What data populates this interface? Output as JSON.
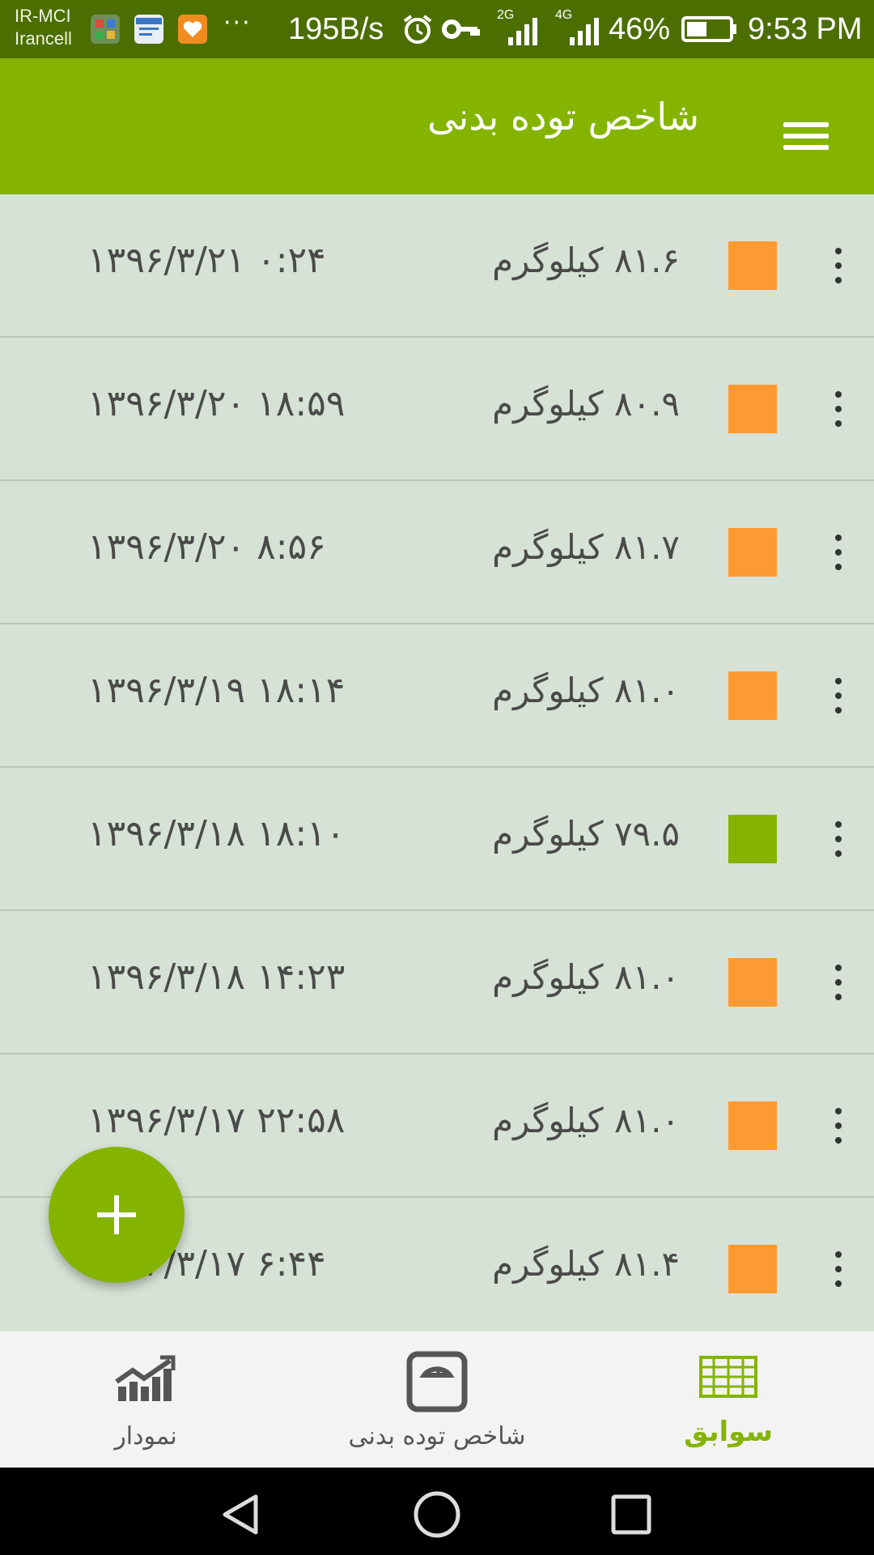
{
  "status_bar": {
    "carrier_line1": "IR-MCI",
    "carrier_line2": "Irancell",
    "more": "···",
    "net_speed": "195B/s",
    "signal_1_label": "2G",
    "signal_2_label": "4G",
    "battery_percent": "46%",
    "time": "9:53 PM"
  },
  "app_bar": {
    "title": "شاخص توده بدنی",
    "menu_icon": "hamburger-menu-icon"
  },
  "colors": {
    "primary": "#85b400",
    "status_bar": "#4c6e00",
    "list_bg": "#d5e2d5",
    "overweight": "#ff9a33",
    "normal": "#85b400",
    "nav_active": "#85b400",
    "nav_inactive": "#555555"
  },
  "records": [
    {
      "weight": "۸۱.۶ کیلوگرم",
      "date": "۱۳۹۶/۳/۲۱ ۰:۲۴",
      "status_color": "#ff9a33"
    },
    {
      "weight": "۸۰.۹ کیلوگرم",
      "date": "۱۳۹۶/۳/۲۰ ۱۸:۵۹",
      "status_color": "#ff9a33"
    },
    {
      "weight": "۸۱.۷ کیلوگرم",
      "date": "۱۳۹۶/۳/۲۰ ۸:۵۶",
      "status_color": "#ff9a33"
    },
    {
      "weight": "۸۱.۰ کیلوگرم",
      "date": "۱۳۹۶/۳/۱۹ ۱۸:۱۴",
      "status_color": "#ff9a33"
    },
    {
      "weight": "۷۹.۵ کیلوگرم",
      "date": "۱۳۹۶/۳/۱۸ ۱۸:۱۰",
      "status_color": "#85b400"
    },
    {
      "weight": "۸۱.۰ کیلوگرم",
      "date": "۱۳۹۶/۳/۱۸ ۱۴:۲۳",
      "status_color": "#ff9a33"
    },
    {
      "weight": "۸۱.۰ کیلوگرم",
      "date": "۱۳۹۶/۳/۱۷ ۲۲:۵۸",
      "status_color": "#ff9a33"
    },
    {
      "weight": "۸۱.۴ کیلوگرم",
      "date": "۱۳۹۶/۳/۱۷ ۶:۴۴",
      "status_color": "#ff9a33"
    }
  ],
  "fab": {
    "icon": "plus-icon"
  },
  "bottom_nav": {
    "tabs": [
      {
        "label": "سوابق",
        "icon": "table-grid-icon",
        "active": true
      },
      {
        "label": "شاخص توده بدنی",
        "icon": "scale-icon",
        "active": false
      },
      {
        "label": "نمودار",
        "icon": "chart-trend-icon",
        "active": false
      }
    ]
  },
  "system_nav": {
    "back": "back-triangle-icon",
    "home": "home-circle-icon",
    "recents": "recents-square-icon"
  }
}
